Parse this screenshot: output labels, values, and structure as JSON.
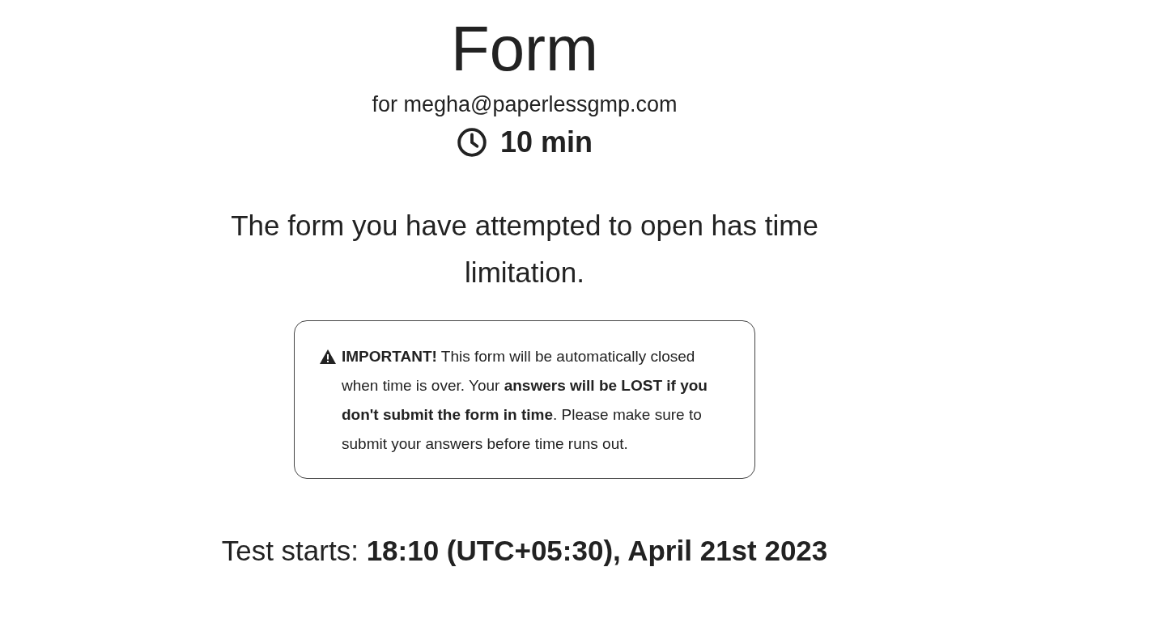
{
  "title": "Form",
  "recipient": "for megha@paperlessgmp.com",
  "duration": "10 min",
  "message": "The form you have attempted to open has time limitation.",
  "warning": "**IMPORTANT!** This form will be automatically closed when time is over. Your **answers will be LOST if you don't submit the form in time**. Please make sure to submit your answers before time runs out.",
  "start": "Test starts: **18:10 (UTC+05:30), April 21st 2023**"
}
